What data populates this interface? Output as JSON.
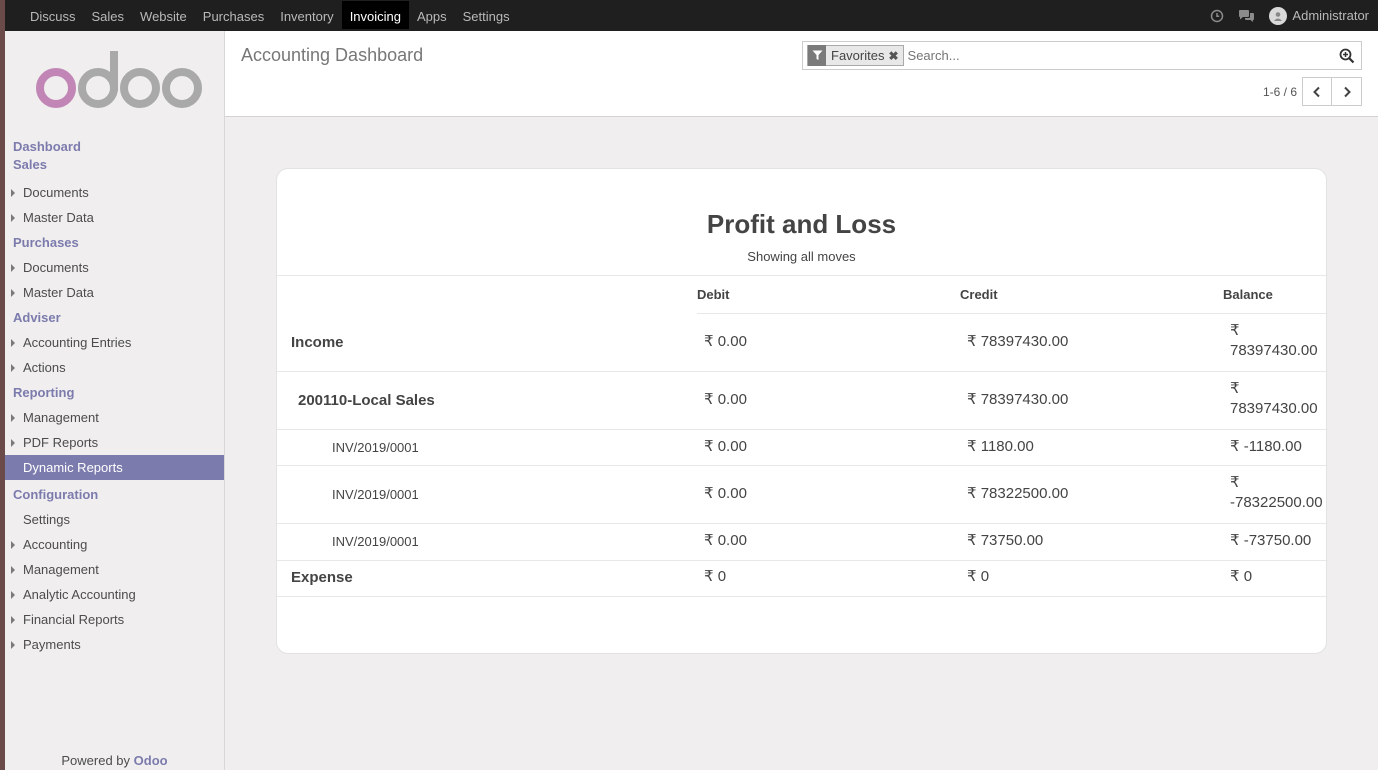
{
  "topbar": {
    "apps": [
      "Discuss",
      "Sales",
      "Website",
      "Purchases",
      "Inventory",
      "Invoicing",
      "Apps",
      "Settings"
    ],
    "active_app": "Invoicing",
    "user": "Administrator"
  },
  "sidebar": {
    "logo_text": "odoo",
    "powered_prefix": "Powered by",
    "powered_brand": "Odoo",
    "sections": [
      {
        "label": "Dashboard",
        "items": []
      },
      {
        "label": "Sales",
        "items": [
          "Documents",
          "Master Data"
        ]
      },
      {
        "label": "Purchases",
        "items": [
          "Documents",
          "Master Data"
        ]
      },
      {
        "label": "Adviser",
        "items": [
          "Accounting Entries",
          "Actions"
        ]
      },
      {
        "label": "Reporting",
        "items": [
          "Management",
          "PDF Reports",
          "Dynamic Reports"
        ]
      },
      {
        "label": "Configuration",
        "items": [
          "Settings",
          "Accounting",
          "Management",
          "Analytic Accounting",
          "Financial Reports",
          "Payments"
        ]
      }
    ],
    "active_item": "Dynamic Reports"
  },
  "control_panel": {
    "title": "Accounting Dashboard",
    "search": {
      "facet": "Favorites",
      "placeholder": "Search..."
    },
    "pager": "1-6 / 6"
  },
  "report": {
    "title": "Profit and Loss",
    "subtitle": "Showing all moves",
    "columns": [
      "Debit",
      "Credit",
      "Balance"
    ],
    "rows": [
      {
        "name": "Income",
        "level": 0,
        "debit": "₹ 0.00",
        "credit": "₹ 78397430.00",
        "balance": "₹ 78397430.00"
      },
      {
        "name": "200110-Local Sales",
        "level": 1,
        "debit": "₹ 0.00",
        "credit": "₹ 78397430.00",
        "balance": "₹ 78397430.00"
      },
      {
        "name": "INV/2019/0001",
        "level": 2,
        "debit": "₹ 0.00",
        "credit": "₹ 1180.00",
        "balance": "₹ -1180.00"
      },
      {
        "name": "INV/2019/0001",
        "level": 2,
        "debit": "₹ 0.00",
        "credit": "₹ 78322500.00",
        "balance": "₹ -78322500.00"
      },
      {
        "name": "INV/2019/0001",
        "level": 2,
        "debit": "₹ 0.00",
        "credit": "₹ 73750.00",
        "balance": "₹ -73750.00"
      },
      {
        "name": "Expense",
        "level": 0,
        "debit": "₹ 0",
        "credit": "₹ 0",
        "balance": "₹ 0"
      }
    ]
  },
  "colors": {
    "accent": "#7c7bad",
    "navbar": "#1f1f1f",
    "sidebar_bg": "#f0eeee"
  }
}
